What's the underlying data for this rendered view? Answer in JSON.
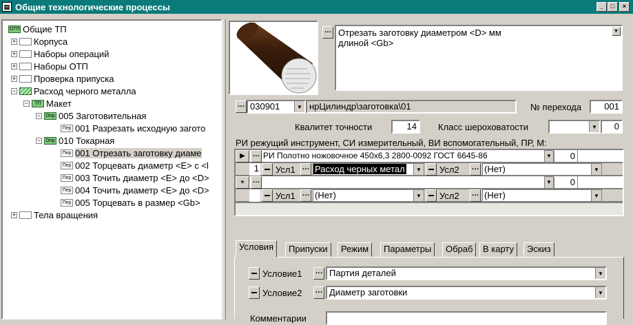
{
  "window": {
    "title": "Общие технологические процессы",
    "icon": "app-icon",
    "buttons": [
      "_",
      "□",
      "×"
    ]
  },
  "tree": {
    "items": [
      {
        "label": "Общие ТП",
        "badge": "ОТП",
        "level": 0
      },
      {
        "label": "Корпуса",
        "level": 1
      },
      {
        "label": "Наборы операций",
        "level": 1
      },
      {
        "label": "Наборы ОТП",
        "level": 1
      },
      {
        "label": "Проверка припуска",
        "level": 1
      },
      {
        "label": "Расход черного металла",
        "level": 1
      },
      {
        "label": "Макет",
        "badge": "ТП",
        "level": 2
      },
      {
        "label": "005 Заготовительная",
        "badge": "Опр",
        "level": 3
      },
      {
        "label": "001 Разрезать исходную загото",
        "badge": "Пер",
        "level": 4
      },
      {
        "label": "010 Токарная",
        "badge": "Опр",
        "level": 3
      },
      {
        "label": "001 Отрезать заготовку диаме",
        "badge": "Пер",
        "level": 4
      },
      {
        "label": "002 Торцевать диаметр <E> с <l",
        "badge": "Пер",
        "level": 4
      },
      {
        "label": "003 Точить диаметр <E> до <D>",
        "badge": "Пер",
        "level": 4
      },
      {
        "label": "004 Точить диаметр <E> до <D>",
        "badge": "Пер",
        "level": 4
      },
      {
        "label": "005 Торцевать в размер <Gb>",
        "badge": "Пер",
        "level": 4
      },
      {
        "label": "Тела вращения",
        "level": 1
      }
    ]
  },
  "detail": {
    "description_line1": "Отрезать заготовку диаметром <D> мм",
    "description_line2": "длиной <Gb>",
    "code": "030901",
    "path": "нрЦилиндр\\заготовка\\01",
    "step_label": "№ перехода",
    "step_value": "001",
    "accuracy_label": "Квалитет точности",
    "accuracy_value": "14",
    "roughness_label": "Класс шероховатости",
    "roughness_value": "",
    "roughness_extra": "0"
  },
  "tools": {
    "header": "РИ режущий инструмент, СИ измерительный, ВИ вспомогательный, ПР, М:",
    "row1": {
      "name": "РИ Полотно ножовочное 450х6,3 2800-0092 ГОСТ 6645-86",
      "qty": "0",
      "index": "1",
      "usl1_label": "Усл1",
      "usl1_value": "Расход черных метал",
      "usl2_label": "Усл2",
      "usl2_value": "(Нет)"
    },
    "row2": {
      "marker": "*",
      "name": "",
      "qty": "0",
      "usl1_label": "Усл1",
      "usl1_value": "(Нет)",
      "usl2_label": "Усл2",
      "usl2_value": "(Нет)"
    }
  },
  "tabs": [
    "Условия",
    "Припуски",
    "Режим",
    "Параметры",
    "Обраб",
    "В карту",
    "Эскиз"
  ],
  "conditions": {
    "cond1_label": "Условие1",
    "cond1_value": "Партия деталей",
    "cond2_label": "Условие2",
    "cond2_value": "Диаметр заготовки",
    "comment_label": "Комментарии",
    "comment_value": ""
  }
}
